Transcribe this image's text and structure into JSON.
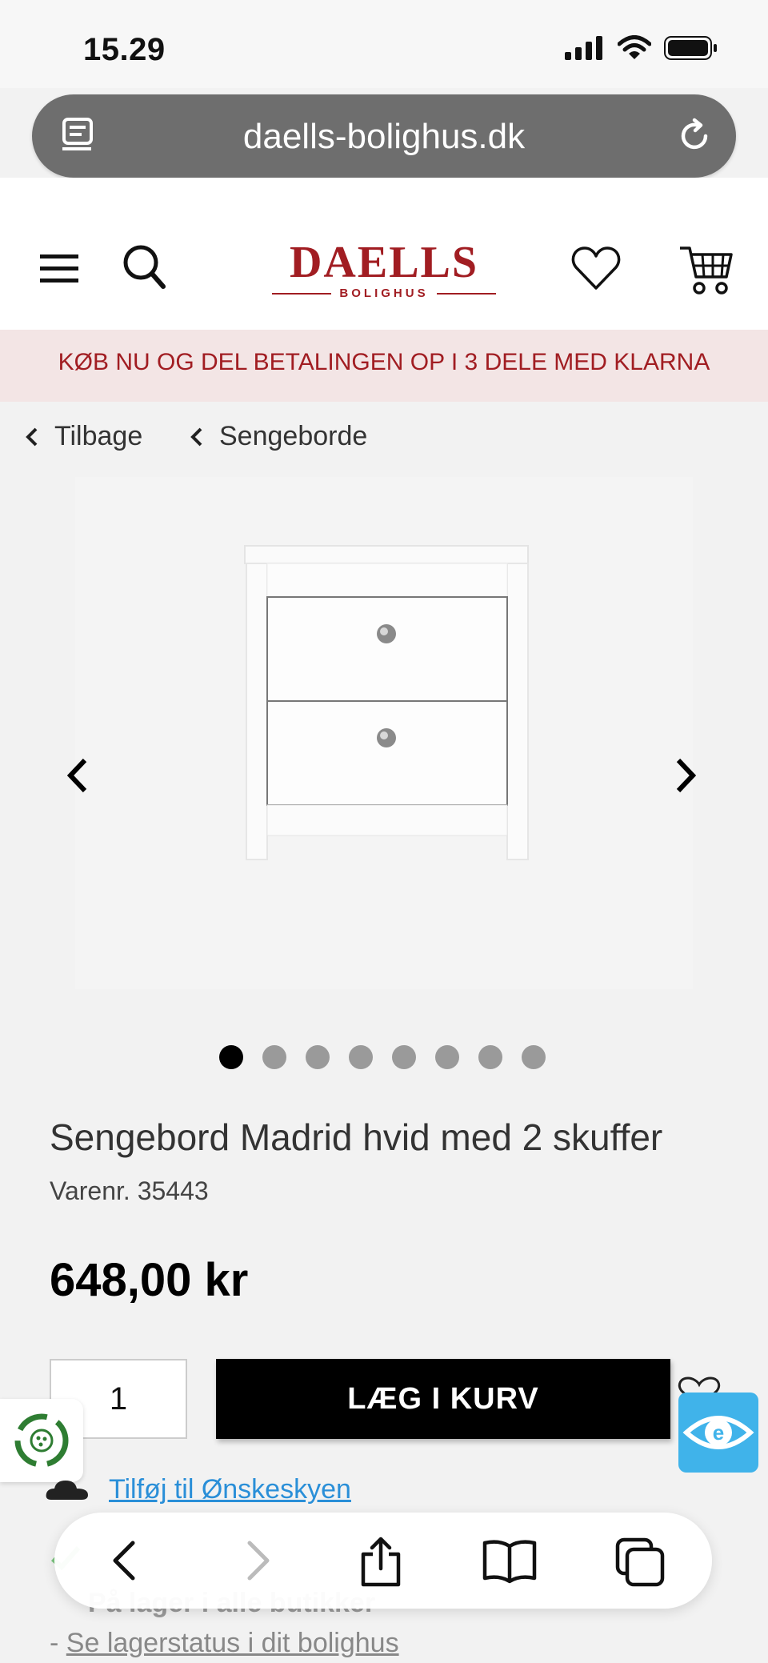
{
  "status_bar": {
    "time": "15.29"
  },
  "browser": {
    "url": "daells-bolighus.dk"
  },
  "header": {
    "logo_main": "DAELLS",
    "logo_sub": "BOLIGHUS",
    "brand_color": "#a11d22"
  },
  "banner": {
    "text": "KØB NU OG DEL BETALINGEN OP I 3 DELE MED KLARNA"
  },
  "breadcrumb": {
    "back_label": "Tilbage",
    "category_label": "Sengeborde"
  },
  "gallery": {
    "dot_count": 8,
    "active_index": 0
  },
  "product": {
    "title": "Sengebord Madrid hvid med 2 skuffer",
    "sku": "Varenr. 35443",
    "price": "648,00 kr"
  },
  "purchase": {
    "quantity": "1",
    "add_to_cart_label": "LÆG I KURV",
    "wishlist_link": "Tilføj til Ønskeskyen"
  },
  "stock": {
    "line_2": "På lager i alle butikker",
    "link_prefix": "- ",
    "link_label": "Se lagerstatus i dit bolighus"
  },
  "icons": {
    "url_left": "reader-icon",
    "url_right": "reload-icon",
    "menu": "hamburger-icon",
    "search": "search-icon",
    "heart": "heart-icon",
    "cart": "cart-icon",
    "toolbar": [
      "back-icon",
      "forward-icon",
      "share-icon",
      "bookmarks-icon",
      "tabs-icon"
    ]
  },
  "colors": {
    "accent_link": "#2a8fd8",
    "eye_badge": "#40b3ea",
    "banner_bg": "#f3e5e5"
  }
}
